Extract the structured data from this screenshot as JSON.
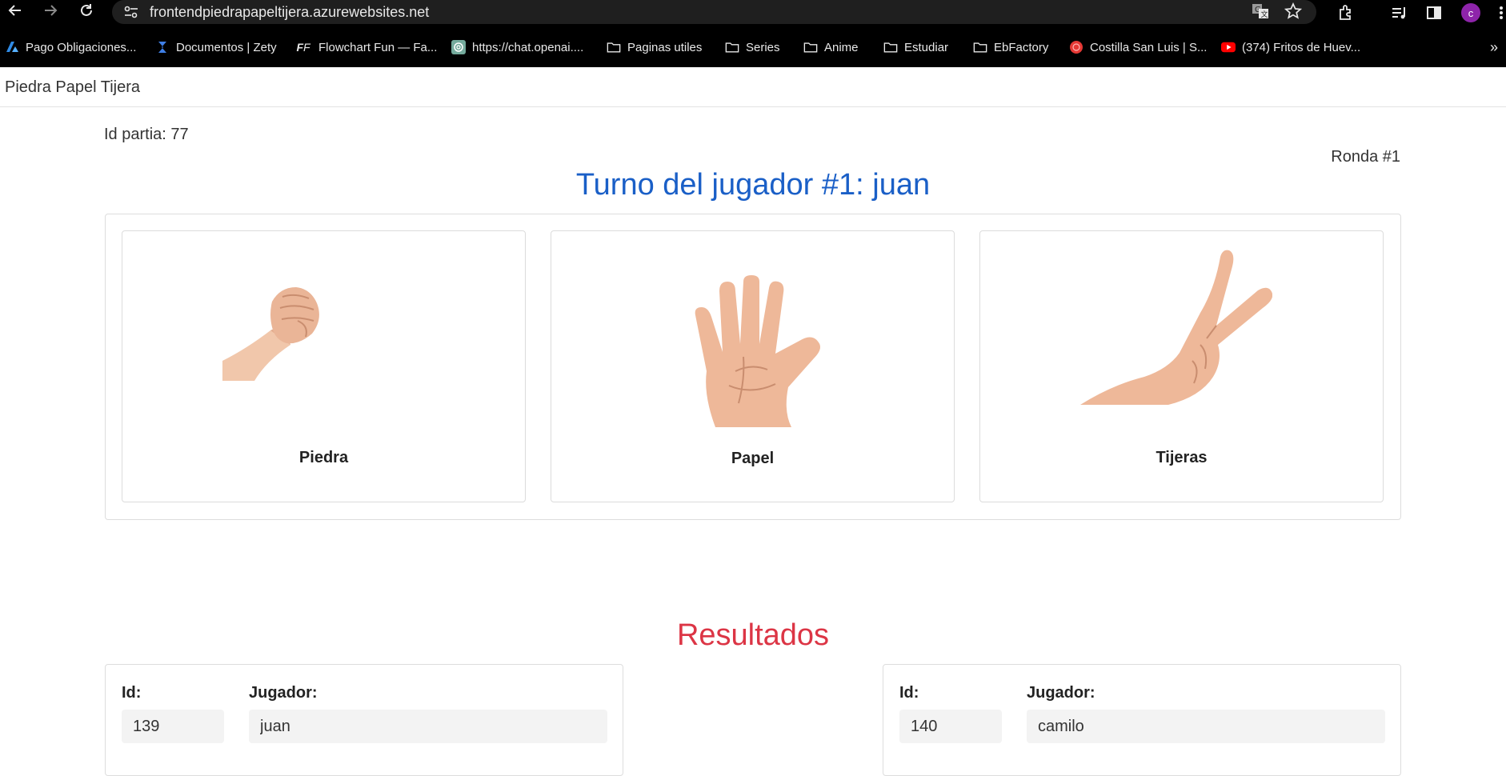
{
  "browser": {
    "url": "frontendpiedrapapeltijera.azurewebsites.net",
    "profile_initial": "c",
    "bookmarks": [
      {
        "label": "Pago Obligaciones...",
        "icon": "azure-icon"
      },
      {
        "label": "Documentos | Zety",
        "icon": "zety-icon"
      },
      {
        "label": "Flowchart Fun — Fa...",
        "icon": "flowchart-icon"
      },
      {
        "label": "https://chat.openai....",
        "icon": "openai-icon"
      },
      {
        "label": "Paginas utiles",
        "icon": "folder-icon"
      },
      {
        "label": "Series",
        "icon": "folder-icon"
      },
      {
        "label": "Anime",
        "icon": "folder-icon"
      },
      {
        "label": "Estudiar",
        "icon": "folder-icon"
      },
      {
        "label": "EbFactory",
        "icon": "folder-icon"
      },
      {
        "label": "Costilla San Luis | S...",
        "icon": "restaurant-icon"
      },
      {
        "label": "(374) Fritos de Huev...",
        "icon": "youtube-icon"
      }
    ],
    "more_bookmarks": "»"
  },
  "app": {
    "brand": "Piedra Papel Tijera",
    "id_partida": "Id partia: 77",
    "ronda": "Ronda #1",
    "turno": "Turno del jugador #1: juan",
    "choices": [
      {
        "label": "Piedra",
        "icon": "fist-hand-image"
      },
      {
        "label": "Papel",
        "icon": "open-palm-image"
      },
      {
        "label": "Tijeras",
        "icon": "victory-hand-image"
      }
    ],
    "resultados_title": "Resultados",
    "results": [
      {
        "id_label": "Id:",
        "id_value": "139",
        "player_label": "Jugador:",
        "player_value": "juan"
      },
      {
        "id_label": "Id:",
        "id_value": "140",
        "player_label": "Jugador:",
        "player_value": "camilo"
      }
    ]
  },
  "colors": {
    "turno": "#1a5fc7",
    "resultados": "#dc3545",
    "profile": "#8e24aa"
  }
}
